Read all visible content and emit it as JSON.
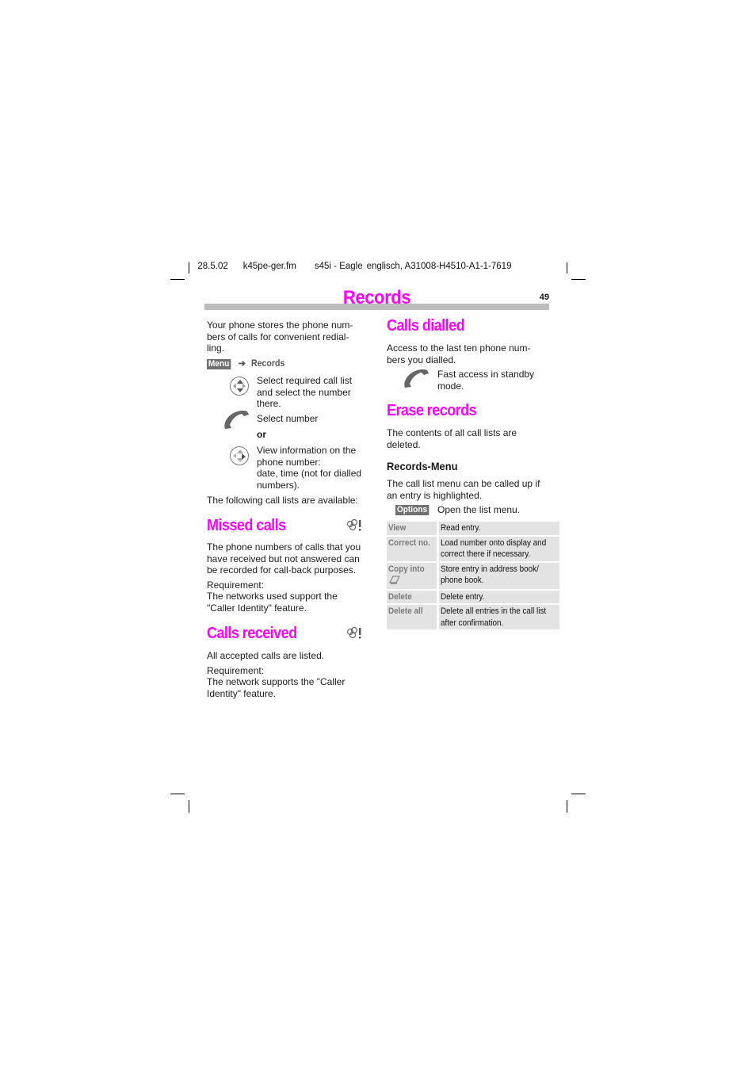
{
  "header": {
    "date": "28.5.02",
    "file": "k45pe-ger.fm",
    "model": "s45i - Eagle",
    "doc_id": "englisch, A31008-H4510-A1-1-7619"
  },
  "page": {
    "title": "Records",
    "number": "49",
    "title_color": "#ff00ff"
  },
  "left": {
    "intro": [
      "Your phone stores the phone num-",
      "bers of calls for convenient redial-",
      "ling."
    ],
    "nav": {
      "key": "Menu",
      "arrow": "➔",
      "target": "Records"
    },
    "steps": [
      {
        "icon": "navigation-key-icon",
        "lines": [
          "Select required call list",
          "and select the number",
          "there."
        ]
      },
      {
        "icon": "call-key-icon",
        "lines": [
          "Select number"
        ]
      },
      {
        "icon": "",
        "lines": [
          "or"
        ]
      },
      {
        "icon": "navigation-key-icon",
        "lines": [
          "View information on the",
          "phone number:",
          "date, time (not for dialled",
          "numbers)."
        ]
      }
    ],
    "available": "The following call lists are available:",
    "missed": {
      "heading": "Missed calls",
      "icon_text": "8!",
      "body": [
        "The phone numbers of calls that you",
        "have received but not answered can",
        "be recorded for call-back purposes."
      ],
      "req_label": "Requirement:",
      "req": [
        "The networks used support the",
        "\"Caller Identity\" feature."
      ]
    },
    "received": {
      "heading": "Calls received",
      "icon_text": "8!",
      "body": [
        "All accepted calls are listed."
      ],
      "req_label": "Requirement:",
      "req": [
        "The network supports the \"Caller",
        "Identity\" feature."
      ]
    }
  },
  "right": {
    "dialled": {
      "heading": "Calls dialled",
      "body": [
        "Access to the last ten phone num-",
        "bers you dialled."
      ],
      "step": [
        "Fast access in standby",
        "mode."
      ]
    },
    "erase": {
      "heading": "Erase records",
      "body": [
        "The contents of all call lists are",
        "deleted."
      ]
    },
    "menu": {
      "heading": "Records-Menu",
      "body": [
        "The call list menu can be called up if",
        "an entry is highlighted."
      ],
      "options_key": "Options",
      "options_text": "Open the list menu.",
      "rows": [
        {
          "key": [
            "View"
          ],
          "value": [
            "Read entry."
          ]
        },
        {
          "key": [
            "Correct no."
          ],
          "value": [
            "Load number onto display and",
            "correct there if necessary."
          ]
        },
        {
          "key": [
            "Copy into"
          ],
          "value": [
            "Store entry in address book/",
            "phone book."
          ],
          "icon": "address-book-icon"
        },
        {
          "key": [
            "Delete"
          ],
          "value": [
            "Delete entry."
          ]
        },
        {
          "key": [
            "Delete all"
          ],
          "value": [
            "Delete all entries in the call list",
            "after confirmation."
          ]
        }
      ]
    }
  }
}
